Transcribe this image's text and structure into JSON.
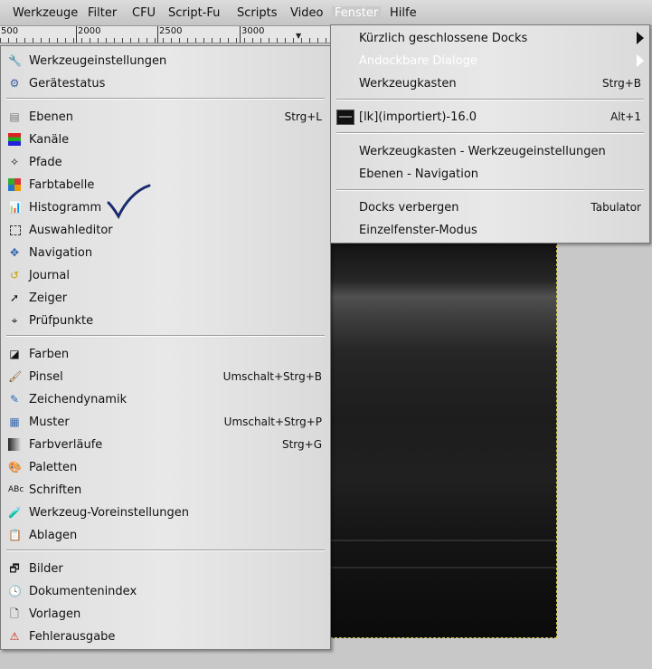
{
  "menubar": {
    "items": [
      "Werkzeuge",
      "Filter",
      "CFU",
      "Script-Fu",
      "Scripts",
      "Video",
      "Fenster",
      "Hilfe"
    ]
  },
  "ruler": {
    "ticks": [
      "500",
      "2000",
      "2500",
      "3000"
    ]
  },
  "dialogs_menu": {
    "items": [
      {
        "label": "Werkzeugeinstellungen",
        "icon": "tool-options-icon",
        "shortcut": ""
      },
      {
        "label": "Gerätestatus",
        "icon": "device-status-icon",
        "shortcut": ""
      },
      {
        "label": "Ebenen",
        "icon": "layers-icon",
        "shortcut": "Strg+L"
      },
      {
        "label": "Kanäle",
        "icon": "channels-icon",
        "shortcut": ""
      },
      {
        "label": "Pfade",
        "icon": "paths-icon",
        "shortcut": ""
      },
      {
        "label": "Farbtabelle",
        "icon": "colormap-icon",
        "shortcut": ""
      },
      {
        "label": "Histogramm",
        "icon": "histogram-icon",
        "shortcut": ""
      },
      {
        "label": "Auswahleditor",
        "icon": "selection-editor-icon",
        "shortcut": ""
      },
      {
        "label": "Navigation",
        "icon": "navigation-icon",
        "shortcut": ""
      },
      {
        "label": "Journal",
        "icon": "journal-icon",
        "shortcut": ""
      },
      {
        "label": "Zeiger",
        "icon": "pointer-icon",
        "shortcut": ""
      },
      {
        "label": "Prüfpunkte",
        "icon": "sample-points-icon",
        "shortcut": ""
      },
      {
        "label": "Farben",
        "icon": "colors-icon",
        "shortcut": ""
      },
      {
        "label": "Pinsel",
        "icon": "brush-icon",
        "shortcut": "Umschalt+Strg+B"
      },
      {
        "label": "Zeichendynamik",
        "icon": "paint-dynamics-icon",
        "shortcut": ""
      },
      {
        "label": "Muster",
        "icon": "patterns-icon",
        "shortcut": "Umschalt+Strg+P"
      },
      {
        "label": "Farbverläufe",
        "icon": "gradients-icon",
        "shortcut": "Strg+G"
      },
      {
        "label": "Paletten",
        "icon": "palettes-icon",
        "shortcut": ""
      },
      {
        "label": "Schriften",
        "icon": "fonts-icon",
        "shortcut": ""
      },
      {
        "label": "Werkzeug-Voreinstellungen",
        "icon": "tool-presets-icon",
        "shortcut": ""
      },
      {
        "label": "Ablagen",
        "icon": "buffers-icon",
        "shortcut": ""
      },
      {
        "label": "Bilder",
        "icon": "images-icon",
        "shortcut": ""
      },
      {
        "label": "Dokumentenindex",
        "icon": "document-history-icon",
        "shortcut": ""
      },
      {
        "label": "Vorlagen",
        "icon": "templates-icon",
        "shortcut": ""
      },
      {
        "label": "Fehlerausgabe",
        "icon": "error-console-icon",
        "shortcut": ""
      }
    ]
  },
  "fenster_menu": {
    "items": [
      {
        "label": "Kürzlich geschlossene Docks",
        "shortcut": ""
      },
      {
        "label": "Andockbare Dialoge",
        "shortcut": ""
      },
      {
        "label": "Werkzeugkasten",
        "shortcut": "Strg+B"
      },
      {
        "label": "[lk](importiert)-16.0",
        "shortcut": "Alt+1"
      },
      {
        "label": "Werkzeugkasten - Werkzeugeinstellungen",
        "shortcut": ""
      },
      {
        "label": "Ebenen - Navigation",
        "shortcut": ""
      },
      {
        "label": "Docks verbergen",
        "shortcut": "Tabulator"
      },
      {
        "label": "Einzelfenster-Modus",
        "shortcut": ""
      }
    ]
  },
  "colors": {
    "highlight_text": "#ffffff",
    "checkmark": "#1a2a6e"
  }
}
